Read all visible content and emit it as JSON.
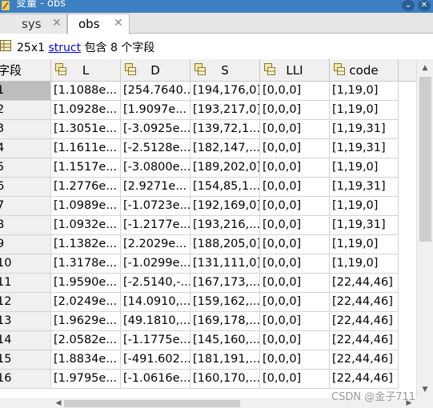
{
  "window": {
    "title": "变量 - obs",
    "close_glyph": "✕",
    "action_glyph": "⌄"
  },
  "tabs": [
    {
      "label": "sys",
      "close": "✕"
    },
    {
      "label": "obs",
      "close": "✕"
    }
  ],
  "info": {
    "size": "25x1",
    "type_link": "struct",
    "suffix": "包含 8 个字段"
  },
  "table": {
    "row_header": "字段",
    "columns": [
      "L",
      "D",
      "S",
      "LLI",
      "code"
    ],
    "rows": [
      {
        "n": "1",
        "cells": [
          "[1.1088e...",
          "[254.7640...",
          "[194,176,0]",
          "[0,0,0]",
          "[1,19,0]"
        ]
      },
      {
        "n": "2",
        "cells": [
          "[1.0928e...",
          "[1.9097e...",
          "[193,217,0]",
          "[0,0,0]",
          "[1,19,0]"
        ]
      },
      {
        "n": "3",
        "cells": [
          "[1.3051e...",
          "[-3.0925e...",
          "[139,72,1...",
          "[0,0,0]",
          "[1,19,31]"
        ]
      },
      {
        "n": "4",
        "cells": [
          "[1.1611e...",
          "[-2.5128e...",
          "[182,147,...",
          "[0,0,0]",
          "[1,19,31]"
        ]
      },
      {
        "n": "5",
        "cells": [
          "[1.1517e...",
          "[-3.0800e...",
          "[189,202,0]",
          "[0,0,0]",
          "[1,19,0]"
        ]
      },
      {
        "n": "6",
        "cells": [
          "[1.2776e...",
          "[2.9271e...",
          "[154,85,1...",
          "[0,0,0]",
          "[1,19,31]"
        ]
      },
      {
        "n": "7",
        "cells": [
          "[1.0989e...",
          "[-1.0723e...",
          "[192,169,0]",
          "[0,0,0]",
          "[1,19,0]"
        ]
      },
      {
        "n": "8",
        "cells": [
          "[1.0932e...",
          "[-1.2177e...",
          "[193,216,...",
          "[0,0,0]",
          "[1,19,31]"
        ]
      },
      {
        "n": "9",
        "cells": [
          "[1.1382e...",
          "[2.2029e...",
          "[188,205,0]",
          "[0,0,0]",
          "[1,19,0]"
        ]
      },
      {
        "n": "10",
        "cells": [
          "[1.3178e...",
          "[-1.0299e...",
          "[131,111,0]",
          "[0,0,0]",
          "[1,19,0]"
        ]
      },
      {
        "n": "11",
        "cells": [
          "[1.9590e...",
          "[-2.5140,-...",
          "[167,173,...",
          "[0,0,0]",
          "[22,44,46]"
        ]
      },
      {
        "n": "12",
        "cells": [
          "[2.0249e...",
          "[14.0910,...",
          "[159,162,...",
          "[0,0,0]",
          "[22,44,46]"
        ]
      },
      {
        "n": "13",
        "cells": [
          "[1.9629e...",
          "[49.1810,...",
          "[169,178,...",
          "[0,0,0]",
          "[22,44,46]"
        ]
      },
      {
        "n": "14",
        "cells": [
          "[2.0582e...",
          "[-1.1775e...",
          "[145,160,...",
          "[0,0,0]",
          "[22,44,46]"
        ]
      },
      {
        "n": "15",
        "cells": [
          "[1.8834e...",
          "[-491.602...",
          "[181,191,...",
          "[0,0,0]",
          "[22,44,46]"
        ]
      },
      {
        "n": "16",
        "cells": [
          "[1.9795e...",
          "[-1.0616e...",
          "[160,170,...",
          "[0,0,0]",
          "[22,44,46]"
        ]
      }
    ]
  },
  "watermark": "CSDN @金子711",
  "colors": {
    "title_bar": "#3c7fc2",
    "link": "#0000ee",
    "selected_row_header": "#bdbdbd"
  },
  "icons": {
    "title": "variable-editor-icon",
    "struct": "struct-icon",
    "field": "field-icon"
  }
}
